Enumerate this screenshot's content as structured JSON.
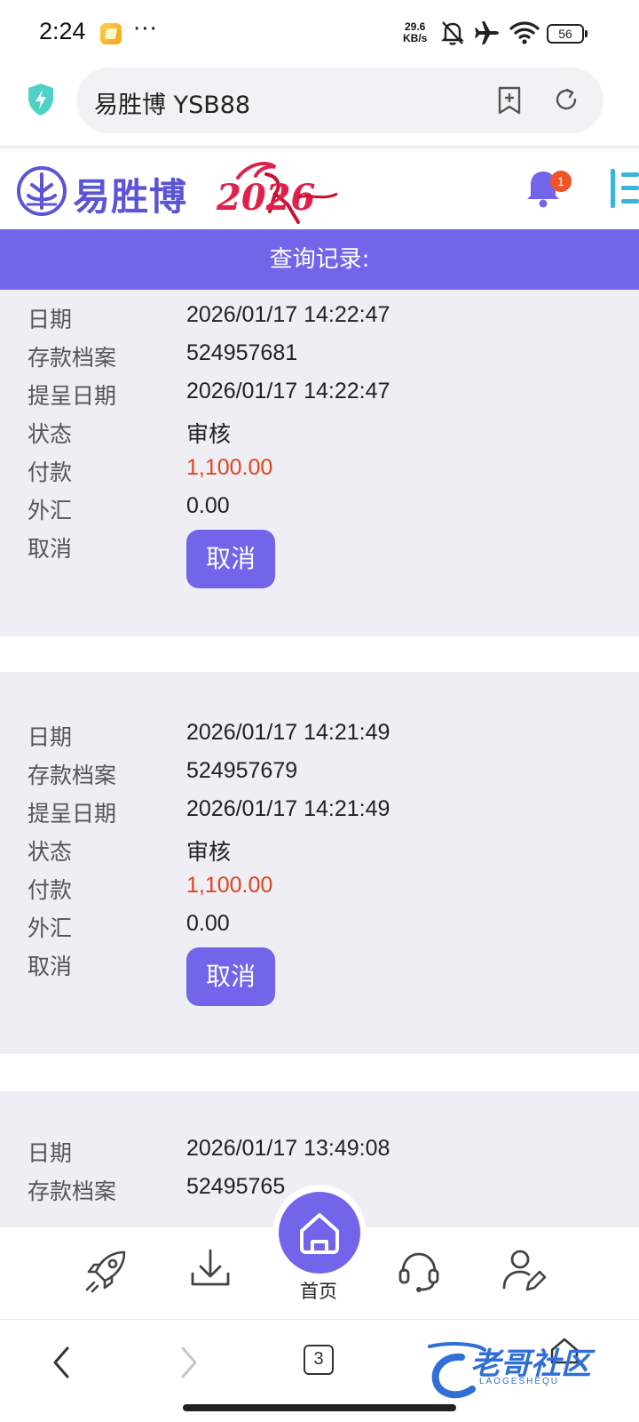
{
  "status_bar": {
    "time": "2:24",
    "dots": "···",
    "speed_top": "29.6",
    "speed_bottom": "KB/s",
    "battery": "56"
  },
  "browser": {
    "url_title": "易胜博 YSB88",
    "tab_count": "3"
  },
  "site": {
    "logo_text": "易胜博",
    "logo_year": "2026",
    "notification_count": "1",
    "page_title": "查询记录:"
  },
  "records": [
    {
      "fields": [
        {
          "label": "日期",
          "value": "2026/01/17 14:22:47"
        },
        {
          "label": "存款档案",
          "value": "524957681"
        },
        {
          "label": "提呈日期",
          "value": "2026/01/17 14:22:47"
        },
        {
          "label": "状态",
          "value": "审核"
        },
        {
          "label": "付款",
          "value": "1,100.00"
        },
        {
          "label": "外汇",
          "value": "0.00"
        },
        {
          "label": "取消",
          "value": ""
        }
      ],
      "cancel_label": "取消"
    },
    {
      "fields": [
        {
          "label": "日期",
          "value": "2026/01/17 14:21:49"
        },
        {
          "label": "存款档案",
          "value": "524957679"
        },
        {
          "label": "提呈日期",
          "value": "2026/01/17 14:21:49"
        },
        {
          "label": "状态",
          "value": "审核"
        },
        {
          "label": "付款",
          "value": "1,100.00"
        },
        {
          "label": "外汇",
          "value": "0.00"
        },
        {
          "label": "取消",
          "value": ""
        }
      ],
      "cancel_label": "取消"
    },
    {
      "fields": [
        {
          "label": "日期",
          "value": "2026/01/17 13:49:08"
        },
        {
          "label": "存款档案",
          "value": "52495765"
        }
      ]
    }
  ],
  "app_nav": {
    "items": [
      "rocket-icon",
      "download-icon",
      "home-icon",
      "headset-icon",
      "user-edit-icon"
    ],
    "home_label": "首页"
  },
  "watermark": {
    "text": "老哥社区",
    "sub": "LAOGESHEQU"
  },
  "colors": {
    "accent": "#7265ea",
    "amount": "#e0441b",
    "card_bg": "#efeef4",
    "logo": "#5b55d6"
  }
}
